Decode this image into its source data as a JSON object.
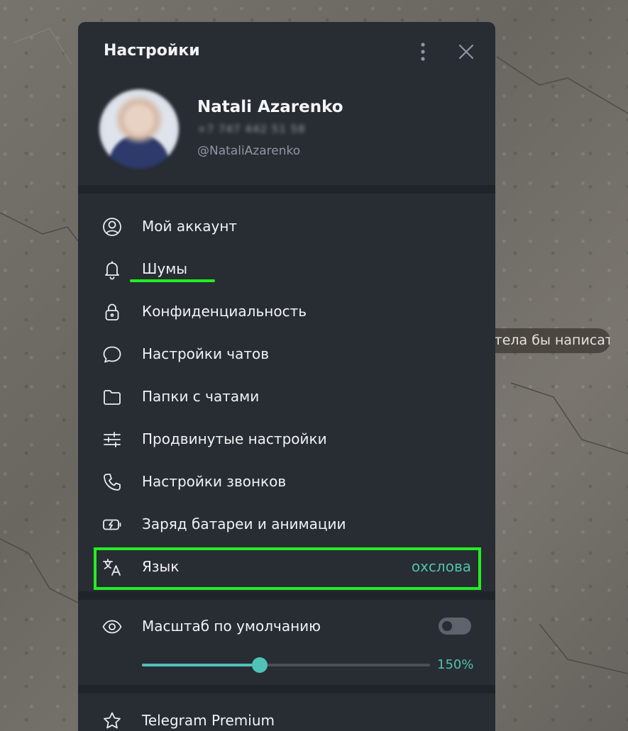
{
  "background": {
    "chat_bubble_text": "Хотела бы написать"
  },
  "settings": {
    "title": "Настройки",
    "icons": {
      "more": "more-vertical-icon",
      "close": "close-icon"
    },
    "profile": {
      "name": "Natali Azarenko",
      "phone": "+7 747 442 51 58",
      "username": "@NataliAzarenko"
    },
    "menu": [
      {
        "label": "Мой аккаунт",
        "icon": "account-icon"
      },
      {
        "label": "Шумы",
        "icon": "bell-icon"
      },
      {
        "label": "Конфиденциальность",
        "icon": "lock-icon"
      },
      {
        "label": "Настройки чатов",
        "icon": "chat-bubble-icon"
      },
      {
        "label": "Папки с чатами",
        "icon": "folder-icon"
      },
      {
        "label": "Продвинутые настройки",
        "icon": "sliders-icon"
      },
      {
        "label": "Настройки звонков",
        "icon": "phone-icon"
      },
      {
        "label": "Заряд батареи и анимации",
        "icon": "battery-icon"
      },
      {
        "label": "Язык",
        "value": "охслова",
        "icon": "translate-icon"
      }
    ],
    "scale": {
      "label": "Масштаб по умолчанию",
      "toggle_on": false,
      "value_text": "150%",
      "slider_fraction": 0.41
    },
    "premium": {
      "label": "Telegram Premium",
      "icon": "star-icon"
    },
    "colors": {
      "accent": "#4fc3b6",
      "highlight": "#22ee22",
      "panel": "#282c33"
    }
  }
}
